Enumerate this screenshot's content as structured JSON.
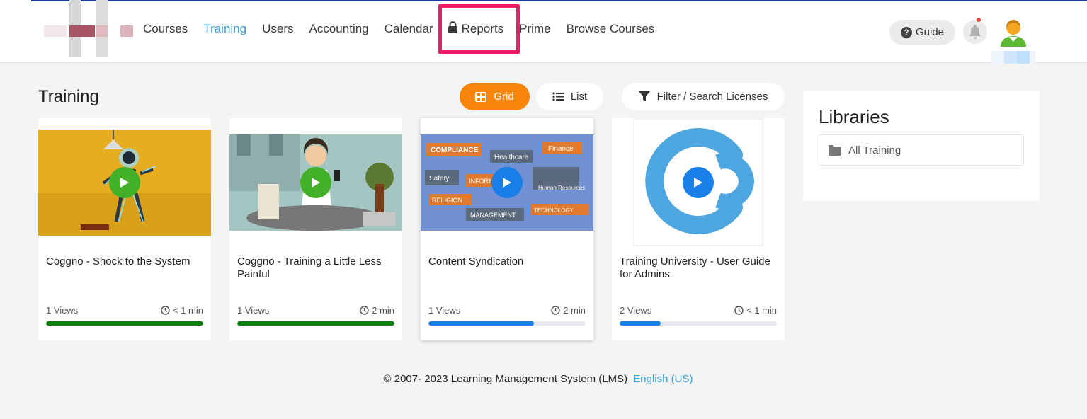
{
  "nav": {
    "items": [
      {
        "label": "Courses"
      },
      {
        "label": "Training",
        "active": true
      },
      {
        "label": "Users"
      },
      {
        "label": "Accounting"
      },
      {
        "label": "Calendar"
      },
      {
        "label": "Reports",
        "icon": "lock-icon"
      },
      {
        "label": "Prime"
      },
      {
        "label": "Browse Courses"
      }
    ],
    "guide_label": "Guide",
    "accent_color": "#3aa0d4",
    "highlight_color": "#ef1a68"
  },
  "main": {
    "title": "Training",
    "grid_label": "Grid",
    "list_label": "List",
    "filter_label": "Filter / Search Licenses",
    "grid_color": "#f7860b"
  },
  "cards": [
    {
      "title": "Coggno - Shock to the System",
      "views": "1 Views",
      "duration": "< 1 min",
      "progress": 1.0,
      "bar_color": "#0f7d12"
    },
    {
      "title": "Coggno - Training a Little Less Painful",
      "views": "1 Views",
      "duration": "2 min",
      "progress": 1.0,
      "bar_color": "#0f7d12"
    },
    {
      "title": "Content Syndication",
      "views": "1 Views",
      "duration": "2 min",
      "progress": 0.67,
      "bar_color": "#1a7fe8"
    },
    {
      "title": "Training University - User Guide for Admins",
      "views": "2 Views",
      "duration": "< 1 min",
      "progress": 0.26,
      "bar_color": "#1a7fe8"
    }
  ],
  "thumb_labels": {
    "compliance": "COMPLIANCE",
    "healthcare": "Healthcare",
    "finance": "Finance",
    "safety": "Safety",
    "information": "INFORM",
    "hr": "Human Resources",
    "religion": "RELIGION",
    "management": "MANAGEMENT",
    "technology": "TECHNOLOGY"
  },
  "libraries": {
    "title": "Libraries",
    "items": [
      {
        "label": "All Training"
      }
    ]
  },
  "footer": {
    "copyright": "© 2007- 2023 Learning Management System (LMS)",
    "language": "English (US)"
  }
}
